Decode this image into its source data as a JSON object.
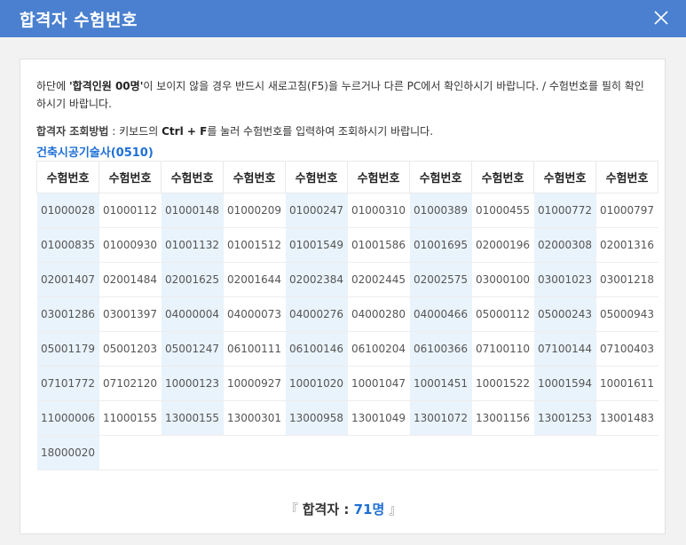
{
  "header": {
    "title": "합격자 수험번호",
    "close_icon": "close-icon"
  },
  "notice": {
    "prefix": "하단에 ",
    "emphasis": "'합격인원 00명'",
    "suffix": "이 보이지 않을 경우 반드시 새로고침(F5)을 누르거나 다른 PC에서 확인하시기 바랍니다. / 수험번호를 필히 확인하시기 바랍니다."
  },
  "search_method": {
    "label": "합격자 조회방법",
    "sep": " : 키보드의 ",
    "keys": "Ctrl + F",
    "rest": "를 눌러 수험번호를 입력하여 조회하시기 바랍니다."
  },
  "subject": "건축시공기술사(0510)",
  "table": {
    "header": "수험번호",
    "columns": 10,
    "numbers": [
      "01000028",
      "01000112",
      "01000148",
      "01000209",
      "01000247",
      "01000310",
      "01000389",
      "01000455",
      "01000772",
      "01000797",
      "01000835",
      "01000930",
      "01001132",
      "01001512",
      "01001549",
      "01001586",
      "01001695",
      "02000196",
      "02000308",
      "02001316",
      "02001407",
      "02001484",
      "02001625",
      "02001644",
      "02002384",
      "02002445",
      "02002575",
      "03000100",
      "03001023",
      "03001218",
      "03001286",
      "03001397",
      "04000004",
      "04000073",
      "04000276",
      "04000280",
      "04000466",
      "05000112",
      "05000243",
      "05000943",
      "05001179",
      "05001203",
      "05001247",
      "06100111",
      "06100146",
      "06100204",
      "06100366",
      "07100110",
      "07100144",
      "07100403",
      "07101772",
      "07102120",
      "10000123",
      "10000927",
      "10001020",
      "10001047",
      "10001451",
      "10001522",
      "10001594",
      "10001611",
      "11000006",
      "11000155",
      "13000155",
      "13000301",
      "13000958",
      "13001049",
      "13001072",
      "13001156",
      "13001253",
      "13001483",
      "18000020"
    ]
  },
  "summary": {
    "open_quote": "『",
    "label": "합격자 : ",
    "count": "71명",
    "close_quote": "』"
  },
  "colors": {
    "header_bg": "#4a80cf",
    "accent": "#1e6fd6",
    "stripe": "#e9f3fb"
  }
}
